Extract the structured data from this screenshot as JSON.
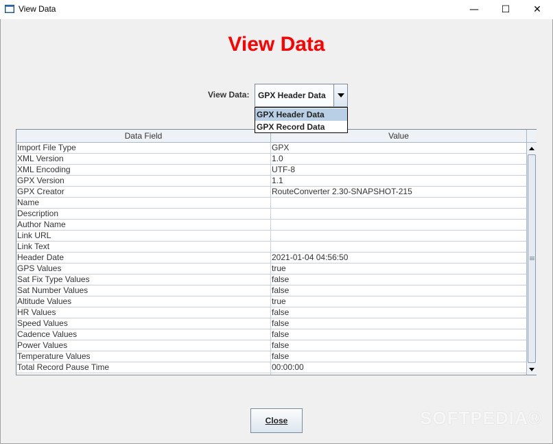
{
  "window": {
    "title": "View Data",
    "minimize_glyph": "—",
    "maximize_glyph": "☐",
    "close_glyph": "✕"
  },
  "heading": "View Data",
  "selector": {
    "label": "View Data:",
    "selected": "GPX Header Data",
    "options": [
      "GPX Header Data",
      "GPX Record Data"
    ]
  },
  "table": {
    "columns": [
      "Data Field",
      "Value"
    ],
    "rows": [
      [
        "Import File Type",
        "GPX"
      ],
      [
        "XML Version",
        "1.0"
      ],
      [
        "XML Encoding",
        "UTF-8"
      ],
      [
        "GPX Version",
        "1.1"
      ],
      [
        "GPX Creator",
        "RouteConverter 2.30-SNAPSHOT-215"
      ],
      [
        "Name",
        ""
      ],
      [
        "Description",
        ""
      ],
      [
        "Author Name",
        ""
      ],
      [
        "Link URL",
        ""
      ],
      [
        "Link Text",
        ""
      ],
      [
        "Header Date",
        "2021-01-04 04:56:50"
      ],
      [
        "GPS Values",
        "true"
      ],
      [
        "Sat Fix Type Values",
        "false"
      ],
      [
        "Sat Number Values",
        "false"
      ],
      [
        "Altitude Values",
        "true"
      ],
      [
        "HR Values",
        "false"
      ],
      [
        "Speed Values",
        "false"
      ],
      [
        "Cadence Values",
        "false"
      ],
      [
        "Power Values",
        "false"
      ],
      [
        "Temperature Values",
        "false"
      ],
      [
        "Total Record Pause Time",
        "00:00:00"
      ]
    ]
  },
  "close_button": "Close",
  "watermark": "SOFTPEDIA®",
  "colors": {
    "heading": "#ff0000",
    "selection": "#b8cfe5"
  },
  "icons": [
    "app-window-icon",
    "minimize-icon",
    "maximize-icon",
    "close-icon",
    "chevron-down-icon",
    "scroll-up-icon",
    "scroll-down-icon"
  ]
}
